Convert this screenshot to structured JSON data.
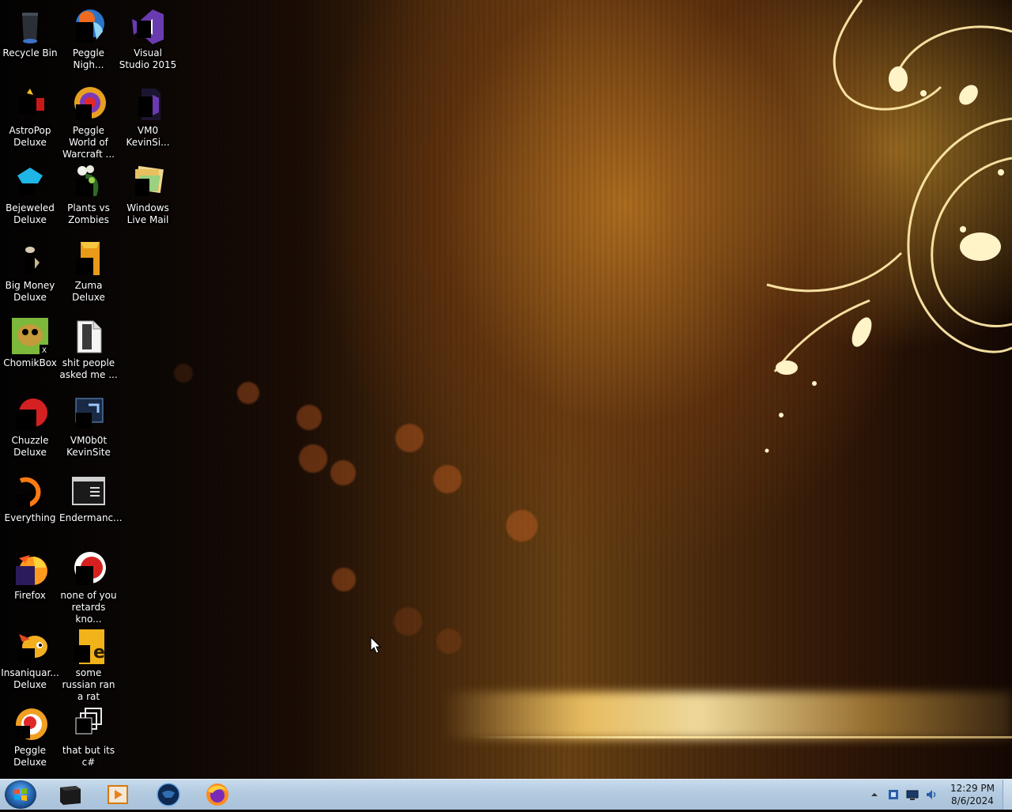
{
  "desktop": {
    "icons": [
      {
        "label": "Recycle Bin",
        "icon": "recycle-bin-icon"
      },
      {
        "label": "Peggle Nigh...",
        "icon": "peggle-nights-icon"
      },
      {
        "label": "Visual Studio 2015",
        "icon": "visual-studio-icon"
      },
      {
        "label": "AstroPop Deluxe",
        "icon": "astropop-icon"
      },
      {
        "label": "Peggle World of Warcraft ...",
        "icon": "peggle-wow-icon"
      },
      {
        "label": "VM0 KevinSi...",
        "icon": "visual-studio-project-icon"
      },
      {
        "label": "Bejeweled Deluxe",
        "icon": "bejeweled-icon"
      },
      {
        "label": "Plants vs Zombies",
        "icon": "plants-vs-zombies-icon"
      },
      {
        "label": "Windows Live Mail",
        "icon": "windows-live-mail-icon"
      },
      {
        "label": "Big Money Deluxe",
        "icon": "big-money-icon"
      },
      {
        "label": "Zuma Deluxe",
        "icon": "zuma-icon"
      },
      {
        "label": "ChomikBox",
        "icon": "chomikbox-icon"
      },
      {
        "label": "shit people asked me ...",
        "icon": "document-icon"
      },
      {
        "label": "Chuzzle Deluxe",
        "icon": "chuzzle-icon"
      },
      {
        "label": "VM0b0t KevinSite",
        "icon": "vm-shortcut-icon"
      },
      {
        "label": "Everything",
        "icon": "everything-search-icon"
      },
      {
        "label": "Endermanc...",
        "icon": "console-window-icon"
      },
      {
        "label": "Firefox",
        "icon": "firefox-icon"
      },
      {
        "label": "none of you retards kno...",
        "icon": "peggle-shortcut-icon"
      },
      {
        "label": "Insaniquar... Deluxe",
        "icon": "insaniquarium-icon"
      },
      {
        "label": "some russian ran a rat",
        "icon": "folder-text-icon"
      },
      {
        "label": "Peggle Deluxe",
        "icon": "peggle-deluxe-icon"
      },
      {
        "label": "that but its c#",
        "icon": "multi-window-icon"
      }
    ]
  },
  "taskbar": {
    "start": "start-orb-icon",
    "pinned": [
      {
        "name": "cmd-window-icon"
      },
      {
        "name": "media-player-icon"
      },
      {
        "name": "globe-app-icon"
      },
      {
        "name": "firefox-icon"
      }
    ],
    "tray": [
      "show-hidden-icons-arrow",
      "network-app-icon",
      "display-icon",
      "volume-icon"
    ],
    "clock": {
      "time": "12:29 PM",
      "date": "8/6/2024"
    }
  }
}
